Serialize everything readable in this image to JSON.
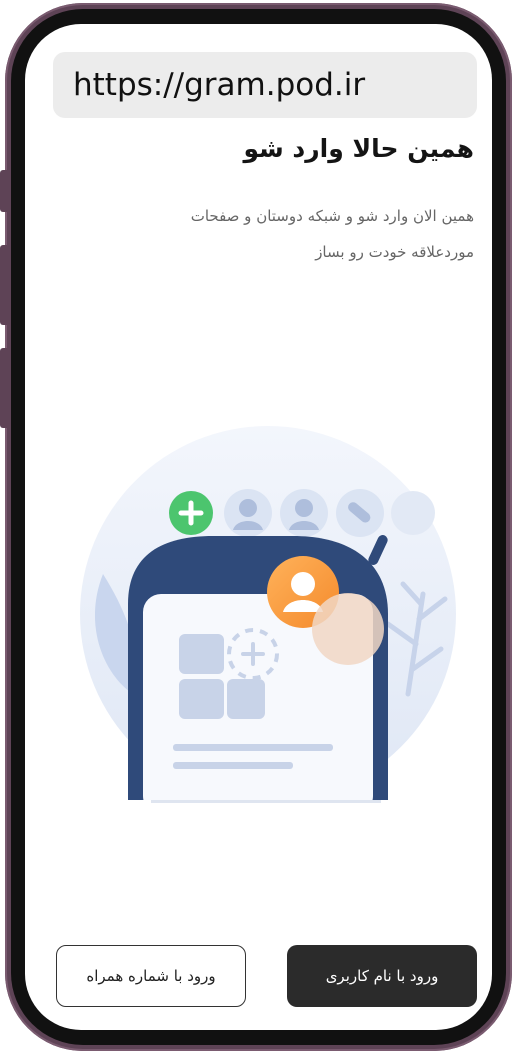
{
  "browser": {
    "url": "https://gram.pod.ir"
  },
  "header": {
    "title": "همین حالا وارد شو",
    "subtitle_line1": "همین الان وارد شو و شبکه دوستان و صفحات",
    "subtitle_line2": "موردعلاقه خودت رو بساز"
  },
  "actions": {
    "primary_label": "ورود با نام کاربری",
    "secondary_label": "ورود با شماره همراه"
  },
  "colors": {
    "frame": "#5e4356",
    "primary_button": "#2b2b2b",
    "illustration_blue": "#2f4a7a"
  },
  "icons": [
    "add-contact-icon",
    "avatar-icon",
    "profile-badge-icon",
    "plant-icon"
  ]
}
